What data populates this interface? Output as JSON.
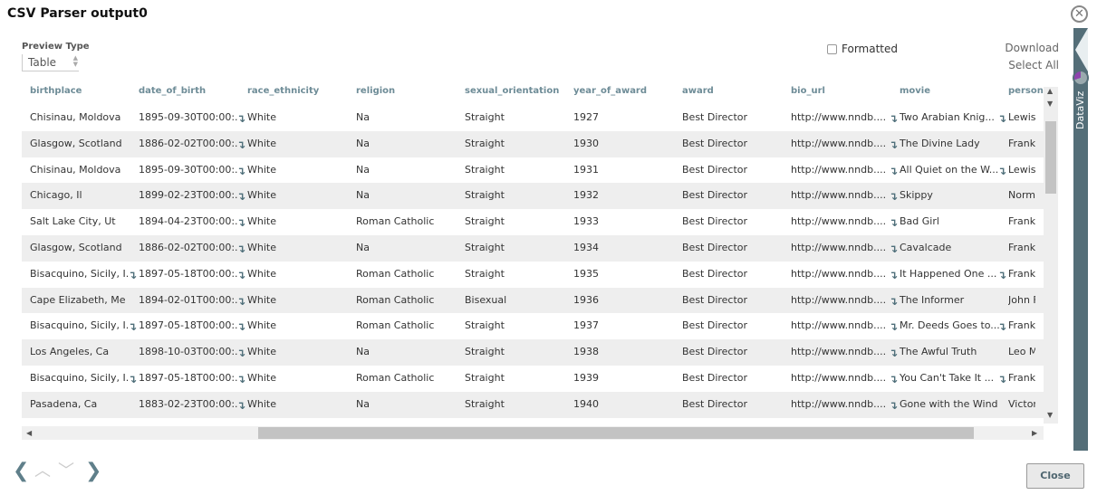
{
  "title": "CSV Parser output0",
  "preview_type": {
    "label": "Preview Type",
    "value": "Table"
  },
  "formatted": {
    "label": "Formatted",
    "checked": false
  },
  "download_label": "Download",
  "select_all_label": "Select All",
  "dataviz_label": "DataViz",
  "close_label": "Close",
  "colors": {
    "header": "#6e8c97",
    "sidebar": "#546e78",
    "alt_row": "#eeeeee"
  },
  "columns": [
    "birthplace",
    "date_of_birth",
    "race_ethnicity",
    "religion",
    "sexual_orientation",
    "year_of_award",
    "award",
    "bio_url",
    "movie",
    "person"
  ],
  "rows": [
    [
      "Chisinau, Moldova",
      "1895-09-30T00:00:...",
      "White",
      "Na",
      "Straight",
      "1927",
      "Best Director",
      "http://www.nndb....",
      "Two Arabian Knig...",
      "Lewis M"
    ],
    [
      "Glasgow, Scotland",
      "1886-02-02T00:00:...",
      "White",
      "Na",
      "Straight",
      "1930",
      "Best Director",
      "http://www.nndb....",
      "The Divine Lady",
      "Frank L"
    ],
    [
      "Chisinau, Moldova",
      "1895-09-30T00:00:...",
      "White",
      "Na",
      "Straight",
      "1931",
      "Best Director",
      "http://www.nndb....",
      "All Quiet on the W...",
      "Lewis M"
    ],
    [
      "Chicago, Il",
      "1899-02-23T00:00:...",
      "White",
      "Na",
      "Straight",
      "1932",
      "Best Director",
      "http://www.nndb....",
      "Skippy",
      "Norma"
    ],
    [
      "Salt Lake City, Ut",
      "1894-04-23T00:00:...",
      "White",
      "Roman Catholic",
      "Straight",
      "1933",
      "Best Director",
      "http://www.nndb....",
      "Bad Girl",
      "Frank B"
    ],
    [
      "Glasgow, Scotland",
      "1886-02-02T00:00:...",
      "White",
      "Na",
      "Straight",
      "1934",
      "Best Director",
      "http://www.nndb....",
      "Cavalcade",
      "Frank L"
    ],
    [
      "Bisacquino, Sicily, I...",
      "1897-05-18T00:00:...",
      "White",
      "Roman Catholic",
      "Straight",
      "1935",
      "Best Director",
      "http://www.nndb....",
      "It Happened One ...",
      "Frank C"
    ],
    [
      "Cape Elizabeth, Me",
      "1894-02-01T00:00:...",
      "White",
      "Roman Catholic",
      "Bisexual",
      "1936",
      "Best Director",
      "http://www.nndb....",
      "The Informer",
      "John Fo"
    ],
    [
      "Bisacquino, Sicily, I...",
      "1897-05-18T00:00:...",
      "White",
      "Roman Catholic",
      "Straight",
      "1937",
      "Best Director",
      "http://www.nndb....",
      "Mr. Deeds Goes to...",
      "Frank C"
    ],
    [
      "Los Angeles, Ca",
      "1898-10-03T00:00:...",
      "White",
      "Na",
      "Straight",
      "1938",
      "Best Director",
      "http://www.nndb....",
      "The Awful Truth",
      "Leo Mc"
    ],
    [
      "Bisacquino, Sicily, I...",
      "1897-05-18T00:00:...",
      "White",
      "Roman Catholic",
      "Straight",
      "1939",
      "Best Director",
      "http://www.nndb....",
      "You Can't Take It ...",
      "Frank C"
    ],
    [
      "Pasadena, Ca",
      "1883-02-23T00:00:...",
      "White",
      "Na",
      "Straight",
      "1940",
      "Best Director",
      "http://www.nndb....",
      "Gone with the Wind",
      "Victor F"
    ]
  ]
}
